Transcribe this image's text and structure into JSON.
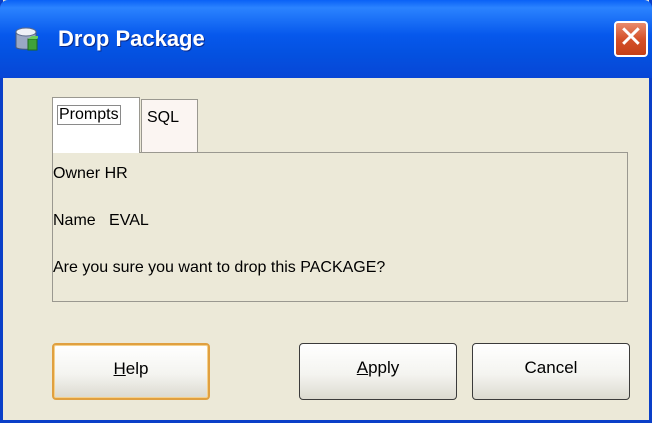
{
  "window": {
    "title": "Drop Package",
    "icon": "package-icon",
    "close_glyph": "✕"
  },
  "tabs": [
    {
      "label": "Prompts",
      "active": true
    },
    {
      "label": "SQL",
      "active": false
    }
  ],
  "prompts": {
    "owner_label": "Owner",
    "owner_value": "HR",
    "name_label": "Name",
    "name_value": "EVAL",
    "confirm_message": "Are you sure you want to drop this PACKAGE?"
  },
  "buttons": {
    "help": {
      "prefix": "",
      "mnemonic": "H",
      "rest": "elp"
    },
    "apply": {
      "prefix": "",
      "mnemonic": "A",
      "rest": "pply"
    },
    "cancel": {
      "label": "Cancel"
    }
  },
  "colors": {
    "titlebar": "#0658ec",
    "close_button": "#d5512a",
    "dialog_bg": "#ece9d8",
    "default_button_focus": "#e0a040"
  }
}
